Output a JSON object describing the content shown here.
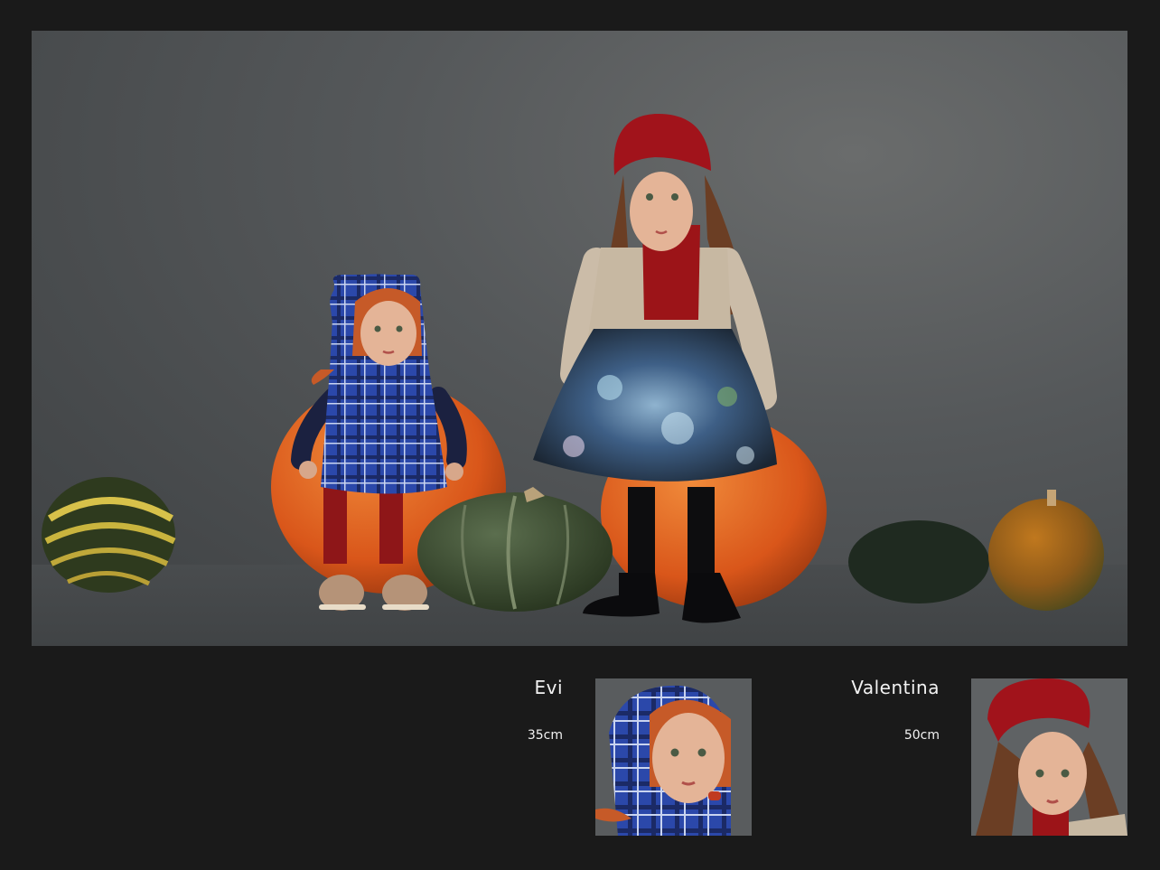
{
  "dolls": [
    {
      "name": "Evi",
      "size": "35cm"
    },
    {
      "name": "Valentina",
      "size": "50cm"
    }
  ],
  "colors": {
    "background": "#1a1a1a",
    "backdrop": "#55585a",
    "pumpkin_orange": "#e0621a",
    "squash_green": "#3e5035",
    "hat_red": "#a1131b",
    "plaid_blue": "#2f4aa8"
  }
}
